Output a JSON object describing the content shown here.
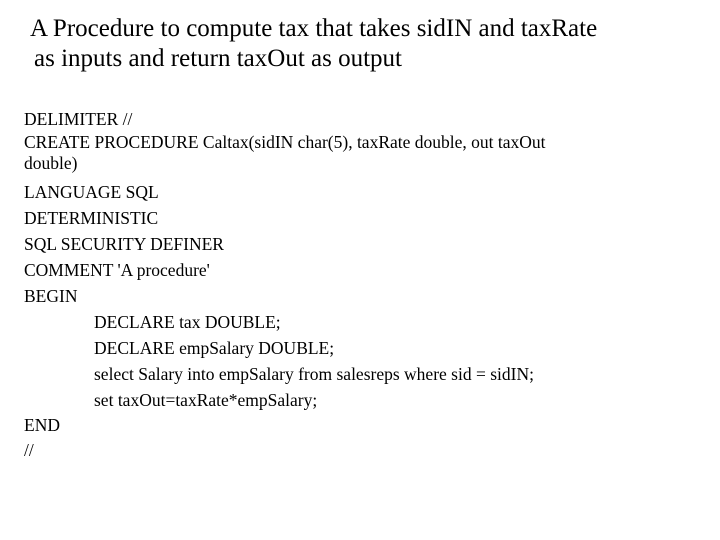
{
  "slide": {
    "background_color": "#ffffff",
    "text_color": "#000000",
    "title": {
      "line1": "A Procedure to compute tax that takes sidIN and taxRate",
      "line2": "as inputs and return taxOut as output"
    },
    "code": {
      "line_01": "DELIMITER //",
      "line_02": "CREATE PROCEDURE Caltax(sidIN char(5), taxRate double, out taxOut",
      "line_02_wrap": "double)",
      "line_03": "LANGUAGE SQL",
      "line_04": "DETERMINISTIC",
      "line_05": "SQL SECURITY DEFINER",
      "line_06": "COMMENT 'A procedure'",
      "line_07": "BEGIN",
      "line_08": "DECLARE tax DOUBLE;",
      "line_09": "DECLARE empSalary DOUBLE;",
      "line_10": "select Salary into empSalary from salesreps where sid = sidIN;",
      "line_11": "set taxOut=taxRate*empSalary;",
      "line_12": "END",
      "line_13": "//"
    }
  }
}
